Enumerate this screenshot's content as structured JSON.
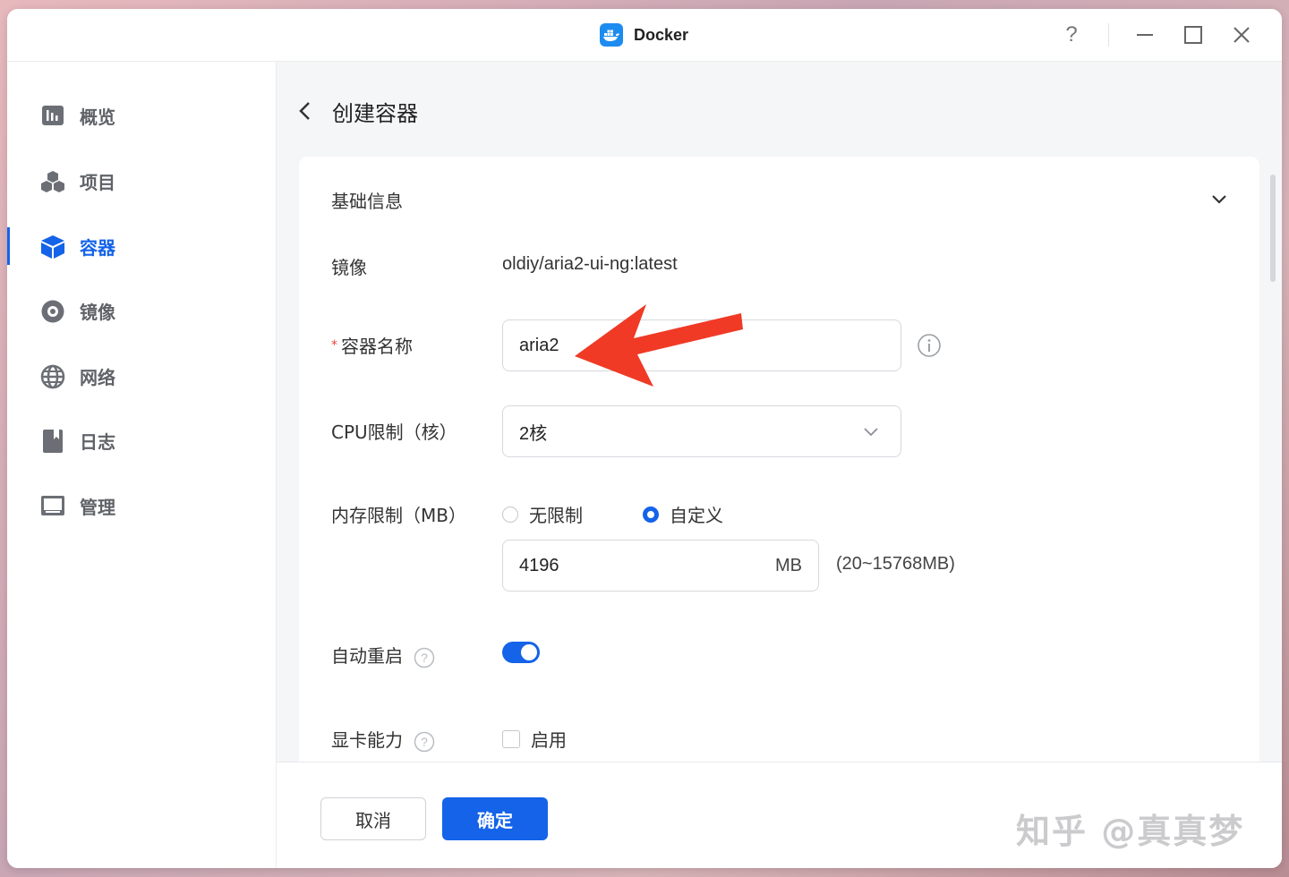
{
  "window": {
    "app_title": "Docker",
    "help_label": "?"
  },
  "sidebar": {
    "items": [
      {
        "label": "概览",
        "icon": "chart-icon"
      },
      {
        "label": "项目",
        "icon": "cubes-icon"
      },
      {
        "label": "容器",
        "icon": "box-icon",
        "active": true
      },
      {
        "label": "镜像",
        "icon": "disc-icon"
      },
      {
        "label": "网络",
        "icon": "globe-icon"
      },
      {
        "label": "日志",
        "icon": "log-book-icon"
      },
      {
        "label": "管理",
        "icon": "monitor-icon"
      }
    ]
  },
  "page": {
    "title": "创建容器",
    "section_title": "基础信息",
    "image": {
      "label": "镜像",
      "value": "oldiy/aria2-ui-ng:latest"
    },
    "container_name": {
      "required_mark": "*",
      "label": "容器名称",
      "value": "aria2"
    },
    "cpu": {
      "label": "CPU限制（核）",
      "selected": "2核"
    },
    "memory": {
      "label": "内存限制（MB）",
      "option_unlimited": "无限制",
      "option_custom": "自定义",
      "selected": "自定义",
      "value": "4196",
      "unit": "MB",
      "range_hint": "(20~15768MB)"
    },
    "auto_restart": {
      "label": "自动重启",
      "enabled": true
    },
    "gpu": {
      "label": "显卡能力",
      "checkbox_label": "启用",
      "checked": false
    }
  },
  "footer": {
    "cancel_label": "取消",
    "ok_label": "确定",
    "watermark": "知乎 @真真梦"
  },
  "colors": {
    "accent": "#1463e8",
    "annotation_arrow": "#f03a26",
    "required": "#e8453c"
  }
}
